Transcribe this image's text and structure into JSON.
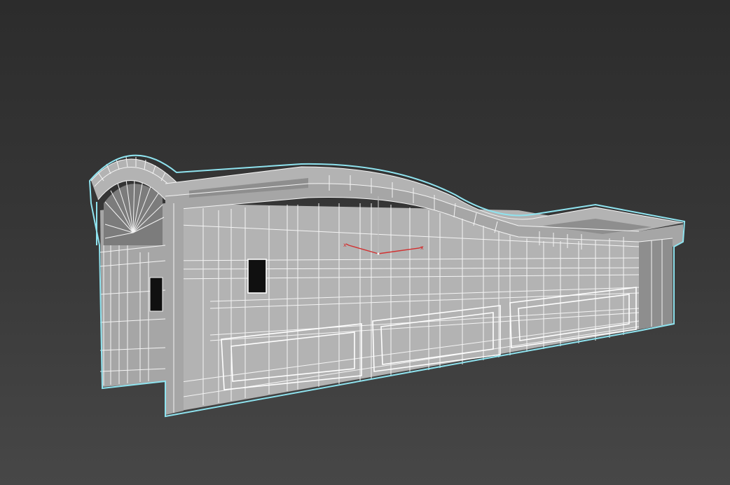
{
  "viewport": {
    "background_top": "#2c2c2c",
    "background_bottom": "#474747",
    "selection_color": "#8fe3ef",
    "wireframe_color": "#f4f4f4",
    "mesh_color": "#b3b3b3"
  },
  "model": {
    "selected": true,
    "display_mode": "shaded-with-edged-faces"
  },
  "gizmo": {
    "x_axis_color": "#d23030",
    "y_axis_color": "#d23030",
    "z_axis_color": "#bbbbbb"
  }
}
